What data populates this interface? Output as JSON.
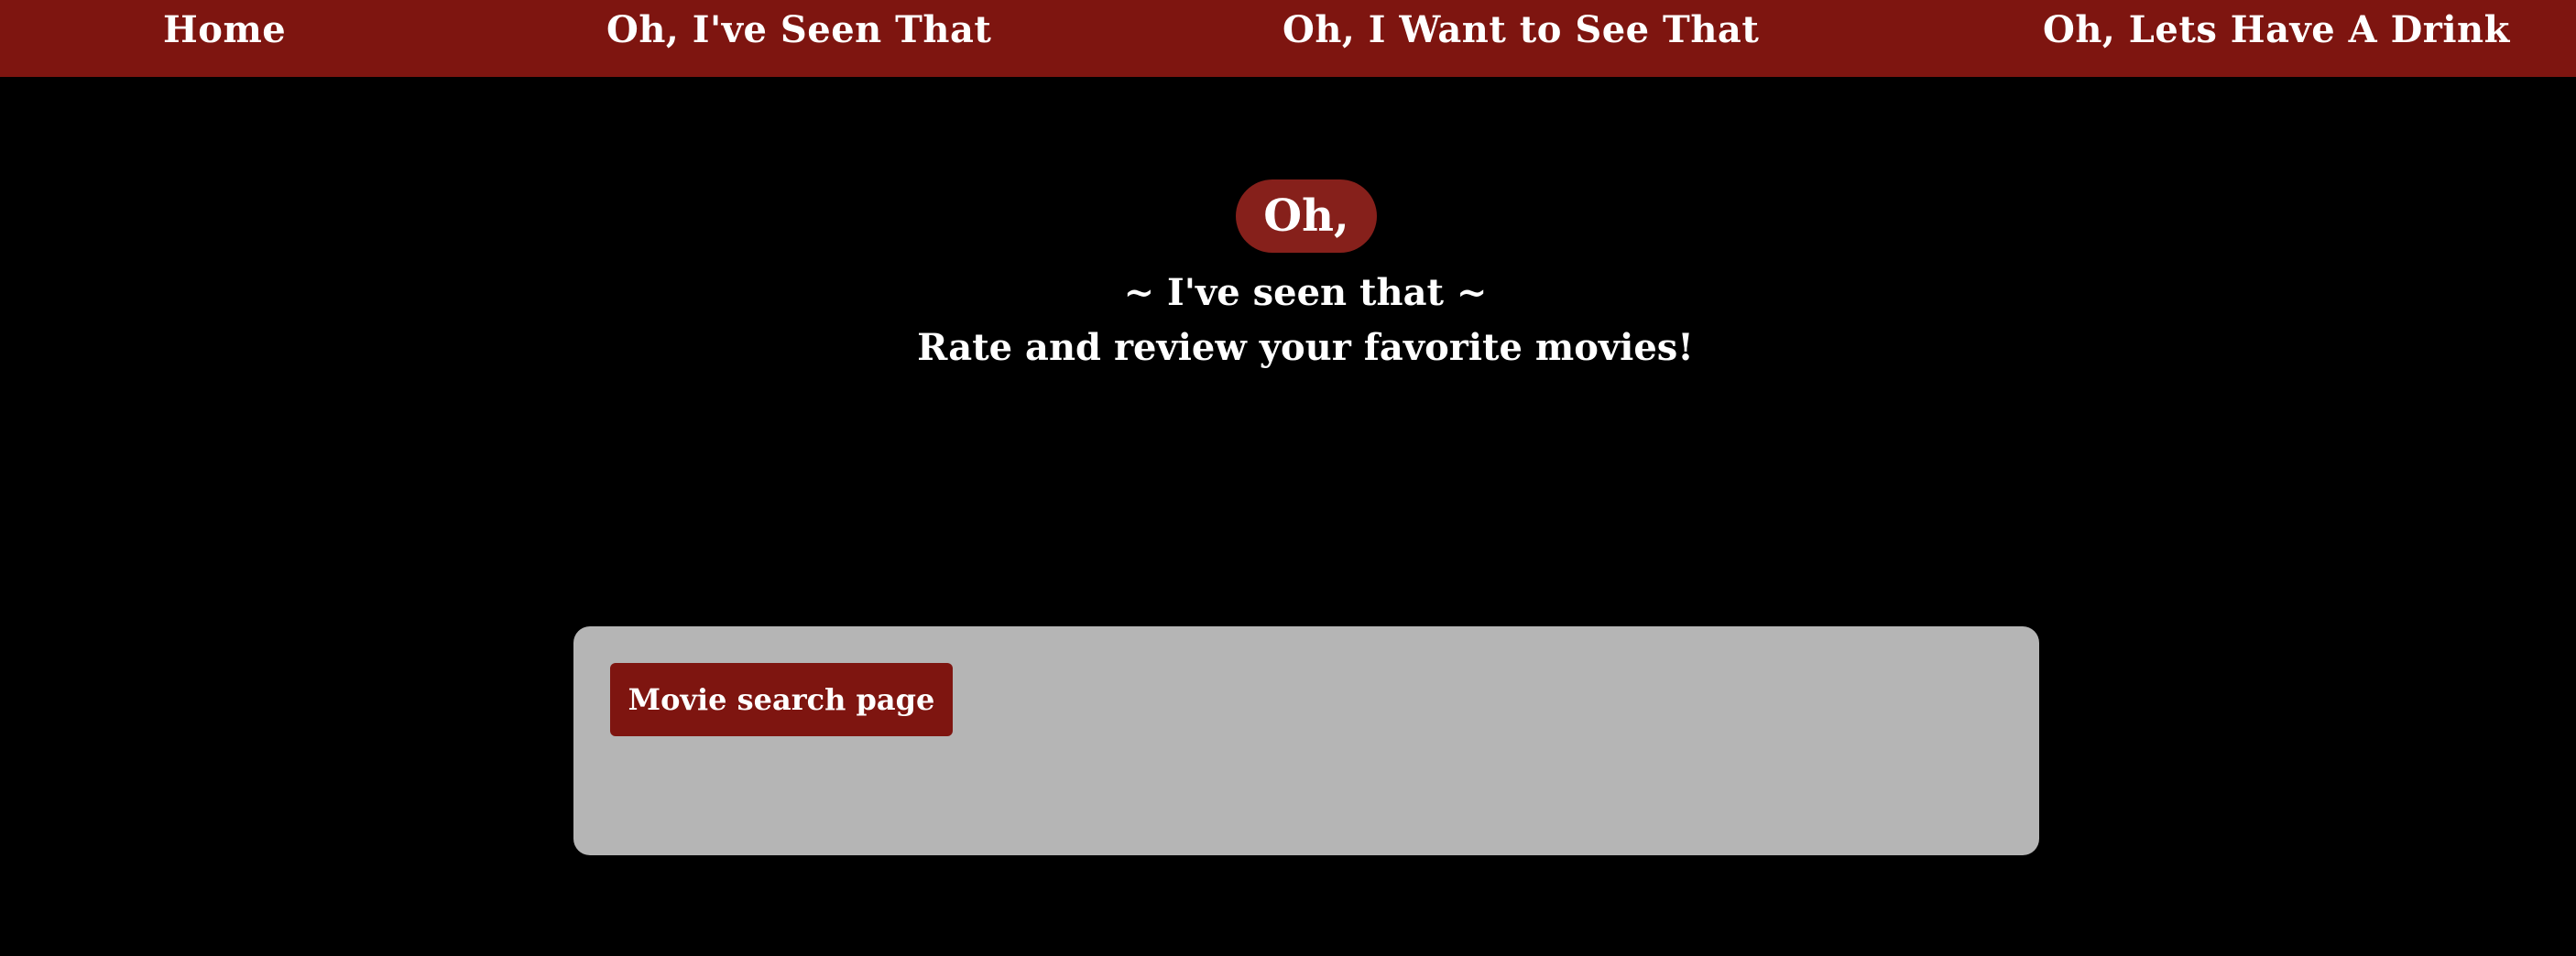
{
  "nav": {
    "items": [
      {
        "label": "Home"
      },
      {
        "label": "Oh, I've Seen That"
      },
      {
        "label": "Oh, I Want to See That"
      },
      {
        "label": "Oh, Lets Have A Drink"
      }
    ]
  },
  "hero": {
    "badge": "Oh,",
    "tagline": "~ I've seen that ~",
    "description": "Rate and review your favorite movies!"
  },
  "panel": {
    "button_label": "Movie search page"
  },
  "colors": {
    "brand": "#7e1510",
    "badge": "#86201b",
    "background": "#000000",
    "panel": "#b5b5b5",
    "text": "#ffffff"
  }
}
